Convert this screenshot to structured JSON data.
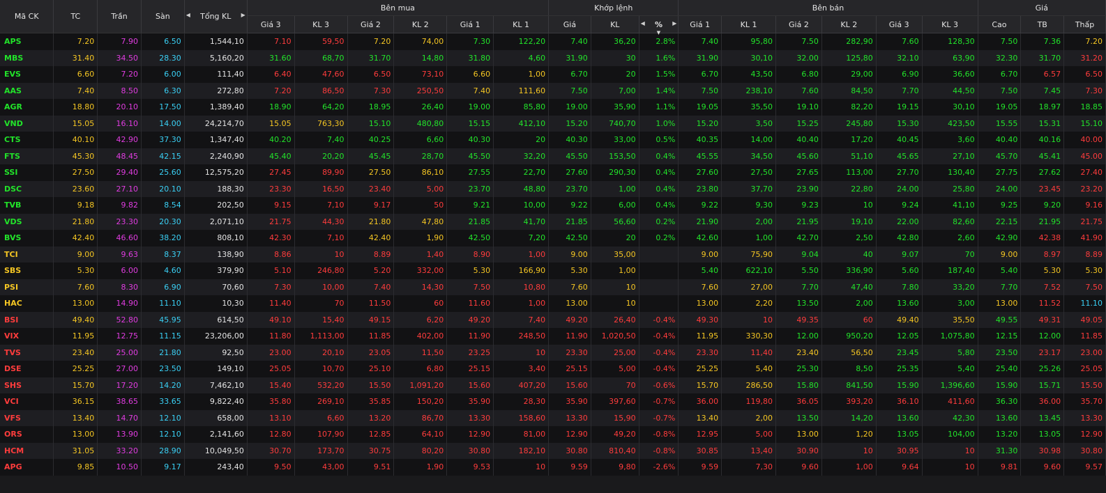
{
  "header": {
    "groups": {
      "buy": "Bên mua",
      "matched": "Khớp lệnh",
      "sell": "Bên bán",
      "price": "Giá"
    },
    "cols": {
      "symbol": "Mã CK",
      "ref": "TC",
      "ceiling": "Trần",
      "floor": "Sàn",
      "total_vol": "Tổng KL",
      "b_p3": "Giá 3",
      "b_v3": "KL 3",
      "b_p2": "Giá 2",
      "b_v2": "KL 2",
      "b_p1": "Giá 1",
      "b_v1": "KL 1",
      "m_price": "Giá",
      "m_vol": "KL",
      "m_pct": "%",
      "s_p1": "Giá 1",
      "s_v1": "KL 1",
      "s_p2": "Giá 2",
      "s_v2": "KL 2",
      "s_p3": "Giá 3",
      "s_v3": "KL 3",
      "high": "Cao",
      "avg": "TB",
      "low": "Thấp"
    },
    "arrow_left": "◀",
    "arrow_right": "▶",
    "sort_down": "▼"
  },
  "colors": {
    "up": "#22e32a",
    "down": "#ff3c3c",
    "reference": "#f5c623",
    "ceiling": "#e03ce0",
    "floor": "#3ad0f5",
    "background": "#121214"
  },
  "rows": [
    [
      "APS",
      "7.20",
      "7.90",
      "6.50",
      "1,544,10",
      "7.10",
      "59,50",
      "7.20",
      "74,00",
      "7.30",
      "122,20",
      "7.40",
      "36,20",
      "2.8%",
      "7.40",
      "95,80",
      "7.50",
      "282,90",
      "7.60",
      "128,30",
      "7.50",
      "7.36",
      "7.20"
    ],
    [
      "MBS",
      "31.40",
      "34.50",
      "28.30",
      "5,160,20",
      "31.60",
      "68,70",
      "31.70",
      "14,80",
      "31.80",
      "4,60",
      "31.90",
      "30",
      "1.6%",
      "31.90",
      "30,10",
      "32.00",
      "125,80",
      "32.10",
      "63,90",
      "32.30",
      "31.70",
      "31.20"
    ],
    [
      "EVS",
      "6.60",
      "7.20",
      "6.00",
      "111,40",
      "6.40",
      "47,60",
      "6.50",
      "73,10",
      "6.60",
      "1,00",
      "6.70",
      "20",
      "1.5%",
      "6.70",
      "43,50",
      "6.80",
      "29,00",
      "6.90",
      "36,60",
      "6.70",
      "6.57",
      "6.50"
    ],
    [
      "AAS",
      "7.40",
      "8.50",
      "6.30",
      "272,80",
      "7.20",
      "86,50",
      "7.30",
      "250,50",
      "7.40",
      "111,60",
      "7.50",
      "7,00",
      "1.4%",
      "7.50",
      "238,10",
      "7.60",
      "84,50",
      "7.70",
      "44,50",
      "7.50",
      "7.45",
      "7.30"
    ],
    [
      "AGR",
      "18.80",
      "20.10",
      "17.50",
      "1,389,40",
      "18.90",
      "64,20",
      "18.95",
      "26,40",
      "19.00",
      "85,80",
      "19.00",
      "35,90",
      "1.1%",
      "19.05",
      "35,50",
      "19.10",
      "82,20",
      "19.15",
      "30,10",
      "19.05",
      "18.97",
      "18.85"
    ],
    [
      "VND",
      "15.05",
      "16.10",
      "14.00",
      "24,214,70",
      "15.05",
      "763,30",
      "15.10",
      "480,80",
      "15.15",
      "412,10",
      "15.20",
      "740,70",
      "1.0%",
      "15.20",
      "3,50",
      "15.25",
      "245,80",
      "15.30",
      "423,50",
      "15.55",
      "15.31",
      "15.10"
    ],
    [
      "CTS",
      "40.10",
      "42.90",
      "37.30",
      "1,347,40",
      "40.20",
      "7,40",
      "40.25",
      "6,60",
      "40.30",
      "20",
      "40.30",
      "33,00",
      "0.5%",
      "40.35",
      "14,00",
      "40.40",
      "17,20",
      "40.45",
      "3,60",
      "40.40",
      "40.16",
      "40.00"
    ],
    [
      "FTS",
      "45.30",
      "48.45",
      "42.15",
      "2,240,90",
      "45.40",
      "20,20",
      "45.45",
      "28,70",
      "45.50",
      "32,20",
      "45.50",
      "153,50",
      "0.4%",
      "45.55",
      "34,50",
      "45.60",
      "51,10",
      "45.65",
      "27,10",
      "45.70",
      "45.41",
      "45.00"
    ],
    [
      "SSI",
      "27.50",
      "29.40",
      "25.60",
      "12,575,20",
      "27.45",
      "89,90",
      "27.50",
      "86,10",
      "27.55",
      "22,70",
      "27.60",
      "290,30",
      "0.4%",
      "27.60",
      "27,50",
      "27.65",
      "113,00",
      "27.70",
      "130,40",
      "27.75",
      "27.62",
      "27.40"
    ],
    [
      "DSC",
      "23.60",
      "27.10",
      "20.10",
      "188,30",
      "23.30",
      "16,50",
      "23.40",
      "5,00",
      "23.70",
      "48,80",
      "23.70",
      "1,00",
      "0.4%",
      "23.80",
      "37,70",
      "23.90",
      "22,80",
      "24.00",
      "25,80",
      "24.00",
      "23.45",
      "23.20"
    ],
    [
      "TVB",
      "9.18",
      "9.82",
      "8.54",
      "202,50",
      "9.15",
      "7,10",
      "9.17",
      "50",
      "9.21",
      "10,00",
      "9.22",
      "6,00",
      "0.4%",
      "9.22",
      "9,30",
      "9.23",
      "10",
      "9.24",
      "41,10",
      "9.25",
      "9.20",
      "9.16"
    ],
    [
      "VDS",
      "21.80",
      "23.30",
      "20.30",
      "2,071,10",
      "21.75",
      "44,30",
      "21.80",
      "47,80",
      "21.85",
      "41,70",
      "21.85",
      "56,60",
      "0.2%",
      "21.90",
      "2,00",
      "21.95",
      "19,10",
      "22.00",
      "82,60",
      "22.15",
      "21.95",
      "21.75"
    ],
    [
      "BVS",
      "42.40",
      "46.60",
      "38.20",
      "808,10",
      "42.30",
      "7,10",
      "42.40",
      "1,90",
      "42.50",
      "7,20",
      "42.50",
      "20",
      "0.2%",
      "42.60",
      "1,00",
      "42.70",
      "2,50",
      "42.80",
      "2,60",
      "42.90",
      "42.38",
      "41.90"
    ],
    [
      "TCI",
      "9.00",
      "9.63",
      "8.37",
      "138,90",
      "8.86",
      "10",
      "8.89",
      "1,40",
      "8.90",
      "1,00",
      "9.00",
      "35,00",
      "",
      "9.00",
      "75,90",
      "9.04",
      "40",
      "9.07",
      "70",
      "9.00",
      "8.97",
      "8.89"
    ],
    [
      "SBS",
      "5.30",
      "6.00",
      "4.60",
      "379,90",
      "5.10",
      "246,80",
      "5.20",
      "332,00",
      "5.30",
      "166,90",
      "5.30",
      "1,00",
      "",
      "5.40",
      "622,10",
      "5.50",
      "336,90",
      "5.60",
      "187,40",
      "5.40",
      "5.30",
      "5.30"
    ],
    [
      "PSI",
      "7.60",
      "8.30",
      "6.90",
      "70,60",
      "7.30",
      "10,00",
      "7.40",
      "14,30",
      "7.50",
      "10,80",
      "7.60",
      "10",
      "",
      "7.60",
      "27,00",
      "7.70",
      "47,40",
      "7.80",
      "33,20",
      "7.70",
      "7.52",
      "7.50"
    ],
    [
      "HAC",
      "13.00",
      "14.90",
      "11.10",
      "10,30",
      "11.40",
      "70",
      "11.50",
      "60",
      "11.60",
      "1,00",
      "13.00",
      "10",
      "",
      "13.00",
      "2,20",
      "13.50",
      "2,00",
      "13.60",
      "3,00",
      "13.00",
      "11.52",
      "11.10"
    ],
    [
      "BSI",
      "49.40",
      "52.80",
      "45.95",
      "614,50",
      "49.10",
      "15,40",
      "49.15",
      "6,20",
      "49.20",
      "7,40",
      "49.20",
      "26,40",
      "-0.4%",
      "49.30",
      "10",
      "49.35",
      "60",
      "49.40",
      "35,50",
      "49.55",
      "49.31",
      "49.05"
    ],
    [
      "VIX",
      "11.95",
      "12.75",
      "11.15",
      "23,206,00",
      "11.80",
      "1,113,00",
      "11.85",
      "402,00",
      "11.90",
      "248,50",
      "11.90",
      "1,020,50",
      "-0.4%",
      "11.95",
      "330,30",
      "12.00",
      "950,20",
      "12.05",
      "1,075,80",
      "12.15",
      "12.00",
      "11.85"
    ],
    [
      "TVS",
      "23.40",
      "25.00",
      "21.80",
      "92,50",
      "23.00",
      "20,10",
      "23.05",
      "11,50",
      "23.25",
      "10",
      "23.30",
      "25,00",
      "-0.4%",
      "23.30",
      "11,40",
      "23.40",
      "56,50",
      "23.45",
      "5,80",
      "23.50",
      "23.17",
      "23.00"
    ],
    [
      "DSE",
      "25.25",
      "27.00",
      "23.50",
      "149,10",
      "25.05",
      "10,70",
      "25.10",
      "6,80",
      "25.15",
      "3,40",
      "25.15",
      "5,00",
      "-0.4%",
      "25.25",
      "5,40",
      "25.30",
      "8,50",
      "25.35",
      "5,40",
      "25.40",
      "25.26",
      "25.05"
    ],
    [
      "SHS",
      "15.70",
      "17.20",
      "14.20",
      "7,462,10",
      "15.40",
      "532,20",
      "15.50",
      "1,091,20",
      "15.60",
      "407,20",
      "15.60",
      "70",
      "-0.6%",
      "15.70",
      "286,50",
      "15.80",
      "841,50",
      "15.90",
      "1,396,60",
      "15.90",
      "15.71",
      "15.50"
    ],
    [
      "VCI",
      "36.15",
      "38.65",
      "33.65",
      "9,822,40",
      "35.80",
      "269,10",
      "35.85",
      "150,20",
      "35.90",
      "28,30",
      "35.90",
      "397,60",
      "-0.7%",
      "36.00",
      "119,80",
      "36.05",
      "393,20",
      "36.10",
      "411,60",
      "36.30",
      "36.00",
      "35.70"
    ],
    [
      "VFS",
      "13.40",
      "14.70",
      "12.10",
      "658,00",
      "13.10",
      "6,60",
      "13.20",
      "86,70",
      "13.30",
      "158,60",
      "13.30",
      "15,90",
      "-0.7%",
      "13.40",
      "2,00",
      "13.50",
      "14,20",
      "13.60",
      "42,30",
      "13.60",
      "13.45",
      "13.30"
    ],
    [
      "ORS",
      "13.00",
      "13.90",
      "12.10",
      "2,141,60",
      "12.80",
      "107,90",
      "12.85",
      "64,10",
      "12.90",
      "81,00",
      "12.90",
      "49,20",
      "-0.8%",
      "12.95",
      "5,00",
      "13.00",
      "1,20",
      "13.05",
      "104,00",
      "13.20",
      "13.05",
      "12.90"
    ],
    [
      "HCM",
      "31.05",
      "33.20",
      "28.90",
      "10,049,50",
      "30.70",
      "173,70",
      "30.75",
      "80,20",
      "30.80",
      "182,10",
      "30.80",
      "810,40",
      "-0.8%",
      "30.85",
      "13,40",
      "30.90",
      "10",
      "30.95",
      "10",
      "31.30",
      "30.98",
      "30.80"
    ],
    [
      "APG",
      "9.85",
      "10.50",
      "9.17",
      "243,40",
      "9.50",
      "43,00",
      "9.51",
      "1,90",
      "9.53",
      "10",
      "9.59",
      "9,80",
      "-2.6%",
      "9.59",
      "7,30",
      "9.60",
      "1,00",
      "9.64",
      "10",
      "9.81",
      "9.60",
      "9.57"
    ]
  ]
}
